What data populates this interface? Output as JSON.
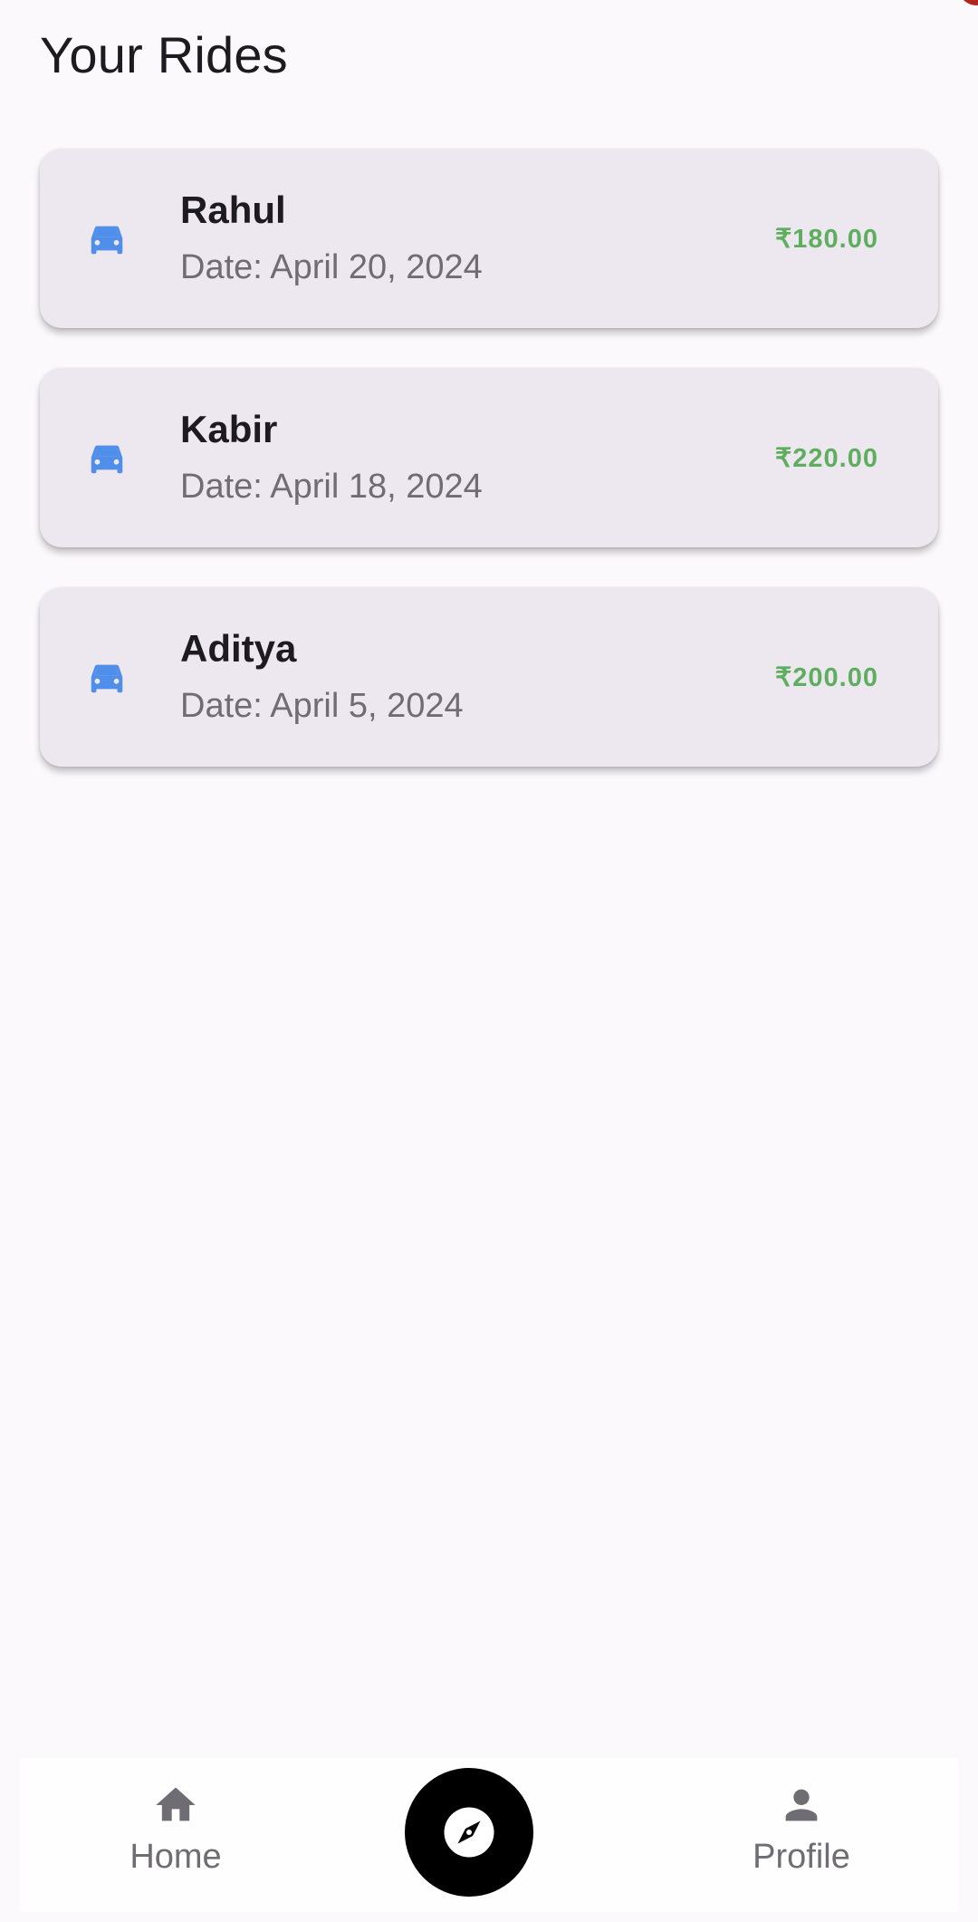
{
  "header": {
    "title": "Your Rides"
  },
  "rides": [
    {
      "name": "Rahul",
      "date": "Date: April 20, 2024",
      "fare": "₹180.00"
    },
    {
      "name": "Kabir",
      "date": "Date: April 18, 2024",
      "fare": "₹220.00"
    },
    {
      "name": "Aditya",
      "date": "Date: April 5, 2024",
      "fare": "₹200.00"
    }
  ],
  "icons": {
    "ride": "car-icon",
    "home": "home-icon",
    "explore": "compass-icon",
    "profile": "person-icon"
  },
  "bottom_nav": {
    "home_label": "Home",
    "profile_label": "Profile"
  },
  "colors": {
    "car_icon": "#4f8ee9",
    "fare": "#5fae5f",
    "card_background": "#ede8f0",
    "fab_background": "#000000"
  }
}
